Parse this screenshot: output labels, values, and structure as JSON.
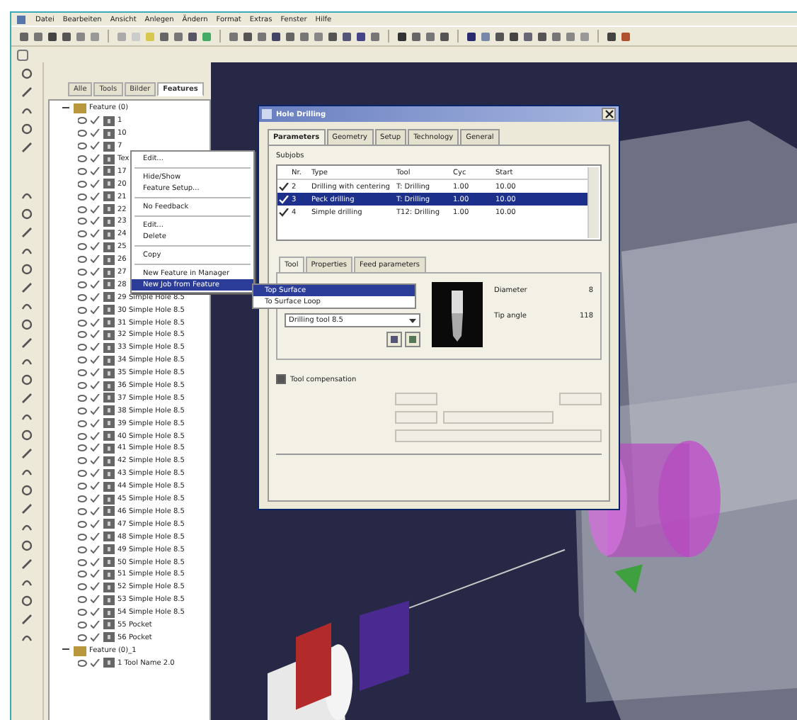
{
  "menu_bar": [
    "Datei",
    "Bearbeiten",
    "Ansicht",
    "Anlegen",
    "Ändern",
    "Format",
    "Extras",
    "Fenster",
    "Hilfe"
  ],
  "panel_tabs": [
    {
      "label": "Alle",
      "selected": false
    },
    {
      "label": "Tools",
      "selected": false
    },
    {
      "label": "Bilder",
      "selected": false
    },
    {
      "label": "Features",
      "selected": true
    }
  ],
  "tree": [
    {
      "label": "Feature (0)",
      "expanded": true,
      "children": [
        {
          "label": "1"
        },
        {
          "label": "10"
        },
        {
          "label": "7"
        },
        {
          "label": "Tex"
        },
        {
          "label": "17"
        },
        {
          "label": "20"
        },
        {
          "label": "21"
        },
        {
          "label": "22"
        },
        {
          "label": "23"
        },
        {
          "label": "24"
        },
        {
          "label": "25"
        },
        {
          "label": "26"
        },
        {
          "label": "27"
        },
        {
          "label": "28"
        },
        {
          "label": "29 Simple Hole 8.5"
        },
        {
          "label": "30 Simple Hole 8.5"
        },
        {
          "label": "31 Simple Hole 8.5"
        },
        {
          "label": "32 Simple Hole 8.5"
        },
        {
          "label": "33 Simple Hole 8.5"
        },
        {
          "label": "34 Simple Hole 8.5"
        },
        {
          "label": "35 Simple Hole 8.5"
        },
        {
          "label": "36 Simple Hole 8.5"
        },
        {
          "label": "37 Simple Hole 8.5"
        },
        {
          "label": "38 Simple Hole 8.5"
        },
        {
          "label": "39 Simple Hole 8.5"
        },
        {
          "label": "40 Simple Hole 8.5"
        },
        {
          "label": "41 Simple Hole 8.5"
        },
        {
          "label": "42 Simple Hole 8.5"
        },
        {
          "label": "43 Simple Hole 8.5"
        },
        {
          "label": "44 Simple Hole 8.5"
        },
        {
          "label": "45 Simple Hole 8.5"
        },
        {
          "label": "46 Simple Hole 8.5"
        },
        {
          "label": "47 Simple Hole 8.5"
        },
        {
          "label": "48 Simple Hole 8.5"
        },
        {
          "label": "49 Simple Hole 8.5"
        },
        {
          "label": "50 Simple Hole 8.5"
        },
        {
          "label": "51 Simple Hole 8.5"
        },
        {
          "label": "52 Simple Hole 8.5"
        },
        {
          "label": "53 Simple Hole 8.5"
        },
        {
          "label": "54 Simple Hole 8.5"
        },
        {
          "label": "55 Pocket"
        },
        {
          "label": "56 Pocket"
        }
      ]
    },
    {
      "label": "Feature (0)_1",
      "expanded": true,
      "children": [
        {
          "label": "1 Tool Name 2.0"
        }
      ]
    }
  ],
  "context_menu": [
    {
      "kind": "item",
      "label": "Edit...",
      "selected": false
    },
    {
      "kind": "separator"
    },
    {
      "kind": "item",
      "label": "Hide/Show",
      "selected": false
    },
    {
      "kind": "item",
      "label": "Feature Setup...",
      "selected": false
    },
    {
      "kind": "separator"
    },
    {
      "kind": "item",
      "label": "No Feedback",
      "selected": false
    },
    {
      "kind": "separator"
    },
    {
      "kind": "item",
      "label": "Edit...",
      "selected": false
    },
    {
      "kind": "item",
      "label": "Delete",
      "selected": false
    },
    {
      "kind": "separator"
    },
    {
      "kind": "item",
      "label": "Copy",
      "selected": false
    },
    {
      "kind": "separator"
    },
    {
      "kind": "item",
      "label": "New Feature in Manager",
      "selected": false
    },
    {
      "kind": "item",
      "label": "New Job from Feature",
      "selected": true
    }
  ],
  "submenu": [
    {
      "label": "Top Surface",
      "selected": true
    },
    {
      "label": "To Surface Loop",
      "selected": false
    }
  ],
  "dialog": {
    "title": "Hole Drilling",
    "tabs": [
      {
        "label": "Parameters",
        "selected": true
      },
      {
        "label": "Geometry",
        "selected": false
      },
      {
        "label": "Setup",
        "selected": false
      },
      {
        "label": "Technology",
        "selected": false
      },
      {
        "label": "General",
        "selected": false
      }
    ],
    "group": "Subjobs",
    "columns": [
      "Nr.",
      "Type",
      "Tool",
      "Cyc",
      "Start"
    ],
    "rows": [
      {
        "checked": true,
        "selected": false,
        "cells": [
          "2",
          "Drilling with centering",
          "T: Drilling",
          "1.00",
          "10.00"
        ]
      },
      {
        "checked": true,
        "selected": true,
        "cells": [
          "3",
          "Peck drilling",
          "T: Drilling",
          "1.00",
          "10.00"
        ]
      },
      {
        "checked": true,
        "selected": false,
        "cells": [
          "4",
          "Simple drilling",
          "T12: Drilling",
          "1.00",
          "10.00"
        ]
      }
    ],
    "tool_tabs": [
      {
        "label": "Tool",
        "selected": true
      },
      {
        "label": "Properties",
        "selected": false
      },
      {
        "label": "Feed parameters",
        "selected": false
      }
    ],
    "tool_select": "Drilling tool 8.5",
    "properties": [
      {
        "label": "Diameter",
        "value": "8"
      },
      {
        "label": "Tip angle",
        "value": "118"
      }
    ],
    "compensation": {
      "label": "Tool compensation",
      "checked": true
    }
  }
}
